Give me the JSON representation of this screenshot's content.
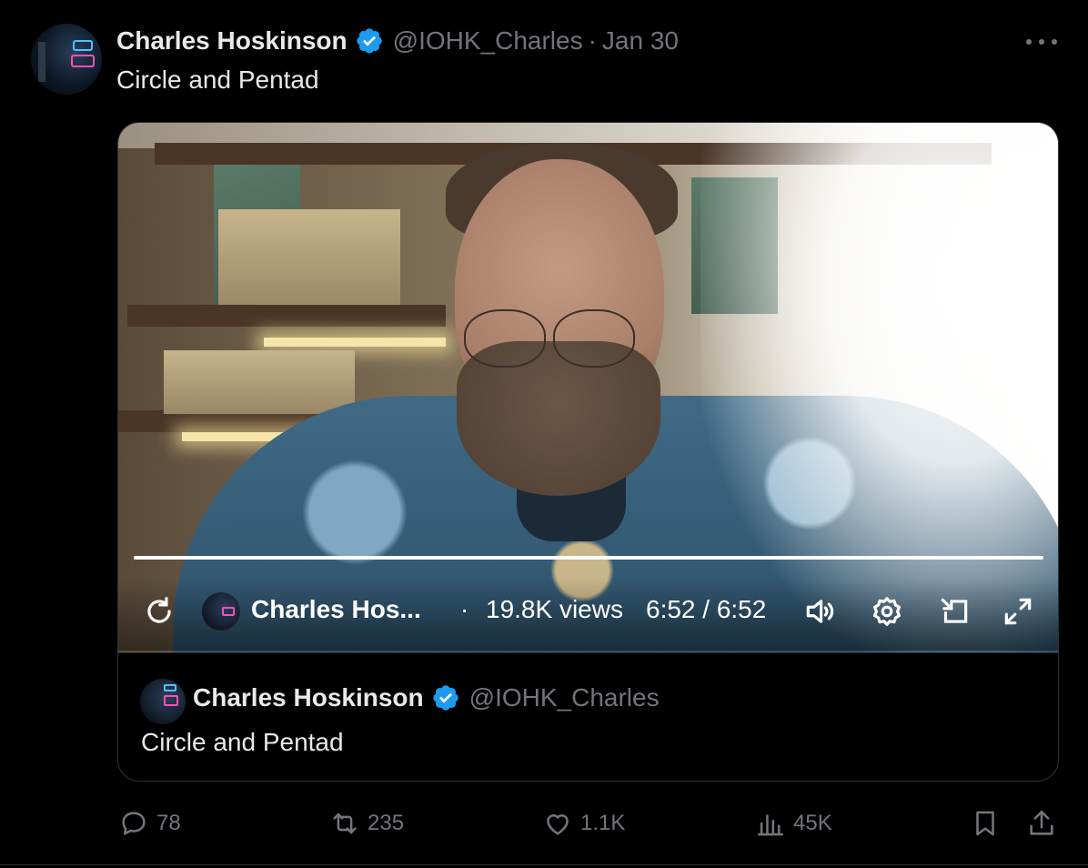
{
  "tweet": {
    "author_name": "Charles Hoskinson",
    "handle": "@IOHK_Charles",
    "separator": "·",
    "date": "Jan 30",
    "text": "Circle and Pentad"
  },
  "video": {
    "channel_name": "Charles Hos...",
    "separator": "·",
    "views": "19.8K views",
    "time": "6:52 / 6:52",
    "progress_fraction": 1.0,
    "icons": [
      "replay-icon",
      "volume-icon",
      "settings-icon",
      "pip-icon",
      "fullscreen-icon"
    ]
  },
  "quoted": {
    "author_name": "Charles Hoskinson",
    "handle": "@IOHK_Charles",
    "text": "Circle and Pentad"
  },
  "actions": {
    "replies": "78",
    "reposts": "235",
    "likes": "1.1K",
    "views": "45K"
  },
  "colors": {
    "background": "#000000",
    "primary_text": "#e7e9ea",
    "secondary_text": "#71767b",
    "verified_blue": "#1d9bf0",
    "border": "#2f3336"
  }
}
